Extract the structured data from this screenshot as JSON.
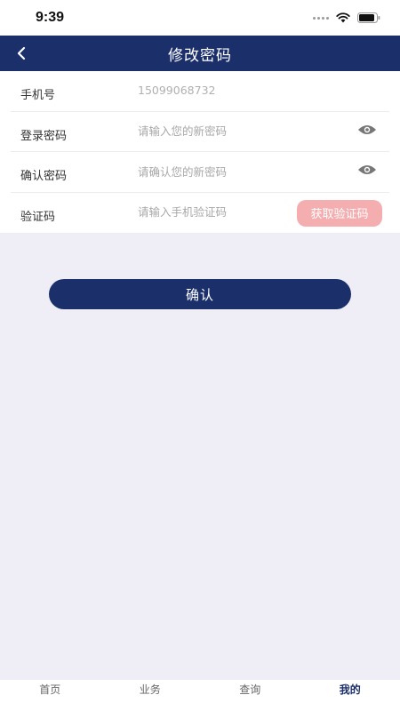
{
  "status": {
    "time": "9:39"
  },
  "nav": {
    "title": "修改密码"
  },
  "form": {
    "phone": {
      "label": "手机号",
      "value": "15099068732"
    },
    "password": {
      "label": "登录密码",
      "placeholder": "请输入您的新密码"
    },
    "confirm_password": {
      "label": "确认密码",
      "placeholder": "请确认您的新密码"
    },
    "code": {
      "label": "验证码",
      "placeholder": "请输入手机验证码",
      "button": "获取验证码"
    }
  },
  "confirm_button": "确认",
  "tabs": [
    {
      "label": "首页"
    },
    {
      "label": "业务"
    },
    {
      "label": "查询"
    },
    {
      "label": "我的",
      "active": true
    }
  ],
  "colors": {
    "primary": "#1b2f6b",
    "code_button": "#f4aeb0",
    "background": "#efedf5"
  },
  "icons": {
    "back": "chevron-left-icon",
    "eye": "eye-icon",
    "wifi": "wifi-icon",
    "battery": "battery-icon"
  }
}
